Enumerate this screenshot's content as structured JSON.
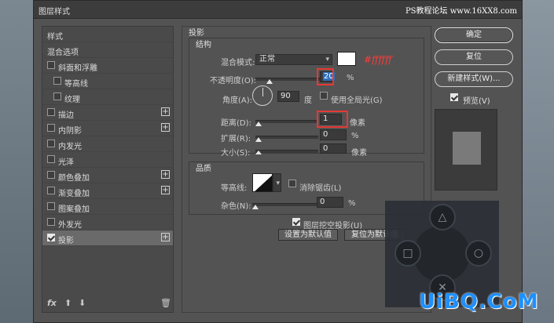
{
  "window": {
    "title": "图层样式",
    "watermark": "PS教程论坛 www.16XX8.com"
  },
  "left_panel": {
    "items": [
      {
        "label": "样式",
        "checkbox": false,
        "plus": false,
        "indent": 0
      },
      {
        "label": "混合选项",
        "checkbox": false,
        "plus": false,
        "indent": 0
      },
      {
        "label": "斜面和浮雕",
        "checkbox": true,
        "checked": false,
        "plus": false,
        "indent": 0
      },
      {
        "label": "等高线",
        "checkbox": true,
        "checked": false,
        "plus": false,
        "indent": 1
      },
      {
        "label": "纹理",
        "checkbox": true,
        "checked": false,
        "plus": false,
        "indent": 1
      },
      {
        "label": "描边",
        "checkbox": true,
        "checked": false,
        "plus": true,
        "indent": 0
      },
      {
        "label": "内阴影",
        "checkbox": true,
        "checked": false,
        "plus": true,
        "indent": 0
      },
      {
        "label": "内发光",
        "checkbox": true,
        "checked": false,
        "plus": false,
        "indent": 0
      },
      {
        "label": "光泽",
        "checkbox": true,
        "checked": false,
        "plus": false,
        "indent": 0
      },
      {
        "label": "颜色叠加",
        "checkbox": true,
        "checked": false,
        "plus": true,
        "indent": 0
      },
      {
        "label": "渐变叠加",
        "checkbox": true,
        "checked": false,
        "plus": true,
        "indent": 0
      },
      {
        "label": "图案叠加",
        "checkbox": true,
        "checked": false,
        "plus": false,
        "indent": 0
      },
      {
        "label": "外发光",
        "checkbox": true,
        "checked": false,
        "plus": false,
        "indent": 0
      },
      {
        "label": "投影",
        "checkbox": true,
        "checked": true,
        "plus": true,
        "indent": 0,
        "selected": true
      }
    ],
    "footer": {
      "fx": "fx",
      "up_icon": "arrow-up-icon",
      "down_icon": "arrow-down-icon",
      "trash_icon": "trash-icon"
    }
  },
  "drop_shadow": {
    "title": "投影",
    "structure": {
      "title": "结构",
      "blend_mode_label": "混合模式:",
      "blend_mode_value": "正常",
      "color_hex_annotation": "#ffffff",
      "opacity_label": "不透明度(O):",
      "opacity_value": "20",
      "opacity_unit": "%",
      "angle_label": "角度(A):",
      "angle_value": "90",
      "angle_unit": "度",
      "global_light_label": "使用全局光(G)",
      "distance_label": "距离(D):",
      "distance_value": "1",
      "distance_unit": "像素",
      "spread_label": "扩展(R):",
      "spread_value": "0",
      "spread_unit": "%",
      "size_label": "大小(S):",
      "size_value": "0",
      "size_unit": "像素"
    },
    "quality": {
      "title": "品质",
      "contour_label": "等高线:",
      "anti_alias_label": "消除锯齿(L)",
      "noise_label": "杂色(N):",
      "noise_value": "0",
      "noise_unit": "%"
    },
    "layer_knocks_out_label": "图层挖空投影(U)",
    "make_default_label": "设置为默认值",
    "reset_default_label": "复位为默认值"
  },
  "right_panel": {
    "ok_label": "确定",
    "reset_label": "复位",
    "new_style_label": "新建样式(W)...",
    "preview_label": "预览(V)"
  },
  "overlay": {
    "logo_text": "UiBQ.CoM"
  },
  "colors": {
    "highlight_red": "#e53935",
    "selection_blue": "#2f6fc0",
    "logo_blue": "#1e90ff"
  }
}
